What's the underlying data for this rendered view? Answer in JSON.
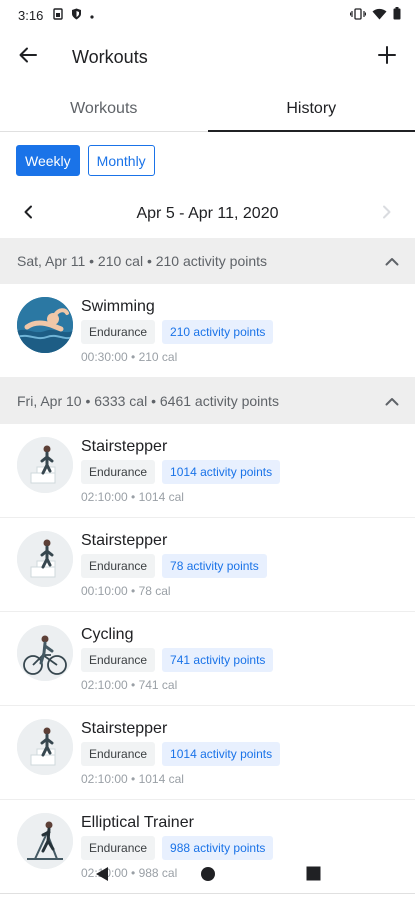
{
  "status_bar": {
    "time": "3:16",
    "left_icons": [
      "sim-icon",
      "shield-icon",
      "dot-icon"
    ],
    "right_icons": [
      "vibrate-icon",
      "wifi-icon",
      "battery-icon"
    ]
  },
  "app_bar": {
    "title": "Workouts"
  },
  "tabs": [
    {
      "label": "Workouts",
      "active": false
    },
    {
      "label": "History",
      "active": true
    }
  ],
  "period": {
    "weekly_label": "Weekly",
    "monthly_label": "Monthly",
    "selected": "Weekly"
  },
  "date_range": "Apr 5 - Apr 11, 2020",
  "groups": [
    {
      "header": "Sat, Apr 11 • 210 cal • 210 activity points",
      "items": [
        {
          "name": "Swimming",
          "category": "Endurance",
          "points": "210 activity points",
          "meta": "00:30:00 • 210 cal",
          "icon": "swimming-icon"
        }
      ]
    },
    {
      "header": "Fri, Apr 10 • 6333 cal • 6461 activity points",
      "items": [
        {
          "name": "Stairstepper",
          "category": "Endurance",
          "points": "1014 activity points",
          "meta": "02:10:00 • 1014 cal",
          "icon": "stairstepper-icon"
        },
        {
          "name": "Stairstepper",
          "category": "Endurance",
          "points": "78 activity points",
          "meta": "00:10:00 • 78 cal",
          "icon": "stairstepper-icon"
        },
        {
          "name": "Cycling",
          "category": "Endurance",
          "points": "741 activity points",
          "meta": "02:10:00 • 741 cal",
          "icon": "cycling-icon"
        },
        {
          "name": "Stairstepper",
          "category": "Endurance",
          "points": "1014 activity points",
          "meta": "02:10:00 • 1014 cal",
          "icon": "stairstepper-icon"
        },
        {
          "name": "Elliptical Trainer",
          "category": "Endurance",
          "points": "988 activity points",
          "meta": "02:10:00 • 988 cal",
          "icon": "elliptical-icon"
        }
      ]
    }
  ],
  "colors": {
    "accent": "#1a73e8",
    "header_bg": "#eeeeee",
    "chip_points_bg": "#e8f0fe"
  }
}
